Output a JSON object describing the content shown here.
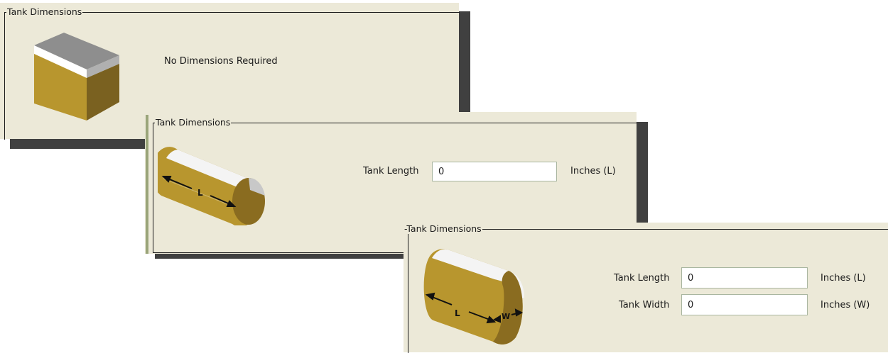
{
  "colors": {
    "panel_bg": "#ece9d8",
    "tank_fill": "#b8962e",
    "tank_top": "#e8e8e8",
    "shadow": "#1e1e1e",
    "field_border": "#a9b6a0"
  },
  "panels": [
    {
      "legend": "Tank Dimensions",
      "shape_icon": "rectangular-tank-icon",
      "message": "No Dimensions Required",
      "fields": []
    },
    {
      "legend": "Tank Dimensions",
      "shape_icon": "horizontal-cylinder-tank-icon",
      "diagram_labels": [
        "L"
      ],
      "fields": [
        {
          "label": "Tank Length",
          "value": "0",
          "unit": "Inches (L)"
        }
      ]
    },
    {
      "legend": "-Tank Dimensions",
      "shape_icon": "elliptical-cylinder-tank-icon",
      "diagram_labels": [
        "L",
        "W"
      ],
      "fields": [
        {
          "label": "Tank Length",
          "value": "0",
          "unit": "Inches (L)"
        },
        {
          "label": "Tank Width",
          "value": "0",
          "unit": "Inches (W)"
        }
      ]
    }
  ]
}
